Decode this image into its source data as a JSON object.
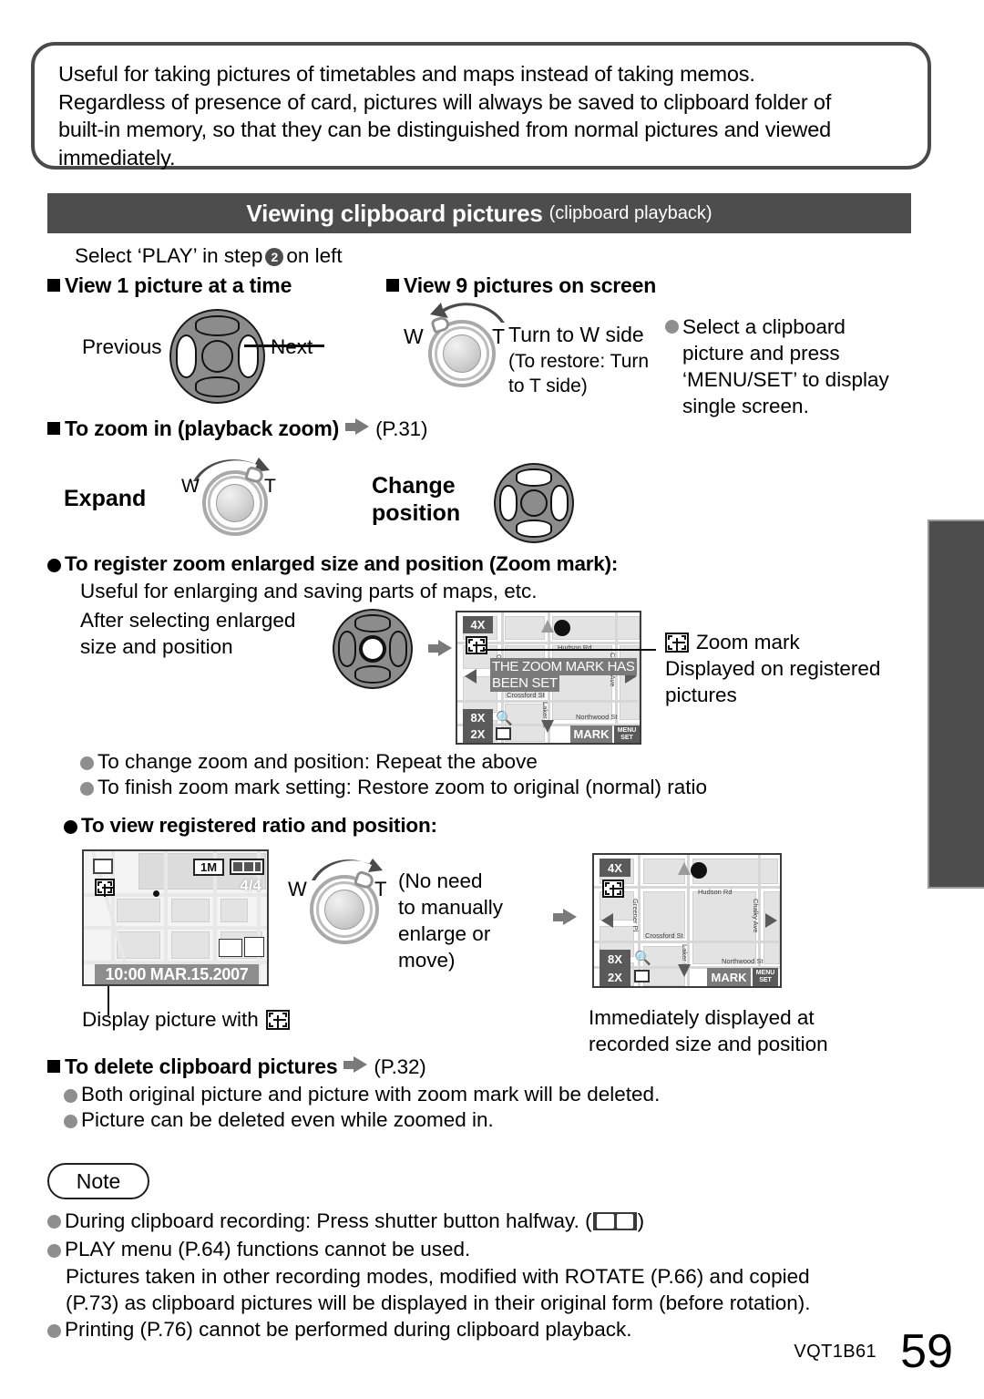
{
  "intro": {
    "lines": [
      "Useful for taking pictures of timetables and maps instead of taking memos.",
      "Regardless of presence of card, pictures will always be saved to clipboard folder of",
      "built-in memory, so that they can be distinguished from normal pictures and viewed",
      "immediately."
    ]
  },
  "banner": {
    "title": "Viewing clipboard pictures",
    "subtitle": "(clipboard playback)",
    "bg_color": "#4d4d4d"
  },
  "select_step": {
    "before": "Select ‘PLAY’ in step",
    "badge": "2",
    "after": "on left"
  },
  "section_view1": {
    "heading": "View 1 picture at a time",
    "left_label": "Previous",
    "right_label": "Next"
  },
  "section_view9": {
    "heading": "View 9 pictures on screen",
    "dial_w": "W",
    "dial_t": "T",
    "turn_label": "Turn to W side",
    "restore_line1": "(To restore: Turn",
    "restore_line2": "to T side)",
    "note_lines": [
      "Select a clipboard",
      "picture and press",
      "‘MENU/SET’ to display",
      "single screen."
    ]
  },
  "section_zoom": {
    "heading": "To zoom in (playback zoom)",
    "page_ref": "(P.31)",
    "expand_label": "Expand",
    "change_label_line1": "Change",
    "change_label_line2": "position",
    "dial_w": "W",
    "dial_t": "T"
  },
  "zoom_mark": {
    "heading": "To register zoom enlarged size and position (Zoom mark):",
    "subtext": "Useful for enlarging and saving parts of maps, etc.",
    "after_line1": "After selecting enlarged",
    "after_line2": "size and position",
    "callout_title": "Zoom mark",
    "callout_line1": "Displayed on registered",
    "callout_line2": "pictures",
    "bullets": [
      "To change zoom and position: Repeat the above",
      "To finish zoom mark setting: Restore zoom to original (normal) ratio"
    ]
  },
  "screen_zoommark": {
    "zoom_top": "4X",
    "zoom_mid": "8X",
    "zoom_bot": "2X",
    "mark_button": "MARK",
    "menu_set": "MENU\nSET",
    "message_line1": "THE ZOOM MARK HAS",
    "message_line2": "BEEN SET",
    "streets": [
      "Hudson Rd",
      "Greener Pl",
      "Crossford St",
      "Laker St",
      "Chalky Ave",
      "Northwood St"
    ]
  },
  "section_view_registered": {
    "heading": "To view registered ratio and position:",
    "no_need_lines": [
      "(No need",
      "to manually",
      "enlarge or",
      "move)"
    ],
    "dial_w": "W",
    "dial_t": "T",
    "display_with": "Display picture with",
    "immediate_line1": "Immediately displayed at",
    "immediate_line2": "recorded size and position"
  },
  "screen_thumb": {
    "size_badge": "1M",
    "counter": "4/4",
    "timestamp": "10:00 MAR.15.2007"
  },
  "screen_result": {
    "zoom_top": "4X",
    "zoom_mid": "8X",
    "zoom_bot": "2X",
    "mark_button": "MARK",
    "menu_set": "MENU\nSET",
    "streets": {
      "hudson": "Hudson Rd",
      "greener": "Greener Pl",
      "crossford": "Crossford St",
      "laker": "Laker St",
      "chalky": "Chalky Ave",
      "northwood": "Northwood St"
    }
  },
  "section_delete": {
    "heading": "To delete clipboard pictures",
    "page_ref": "(P.32)",
    "bullets": [
      "Both original picture and picture with zoom mark will be deleted.",
      "Picture can be deleted even while zoomed in."
    ]
  },
  "note": {
    "label": "Note",
    "bullets": [
      "During clipboard recording: Press shutter button halfway. (",
      "PLAY menu (P.64) functions cannot be used.",
      "Printing (P.76) cannot be performed during clipboard playback."
    ],
    "close_paren": ")",
    "paragraph_lines": [
      "Pictures taken in other recording modes, modified with ROTATE (P.66) and copied",
      "(P.73) as clipboard pictures will be displayed in their original form (before rotation)."
    ]
  },
  "footer": {
    "code": "VQT1B61",
    "page": "59"
  }
}
